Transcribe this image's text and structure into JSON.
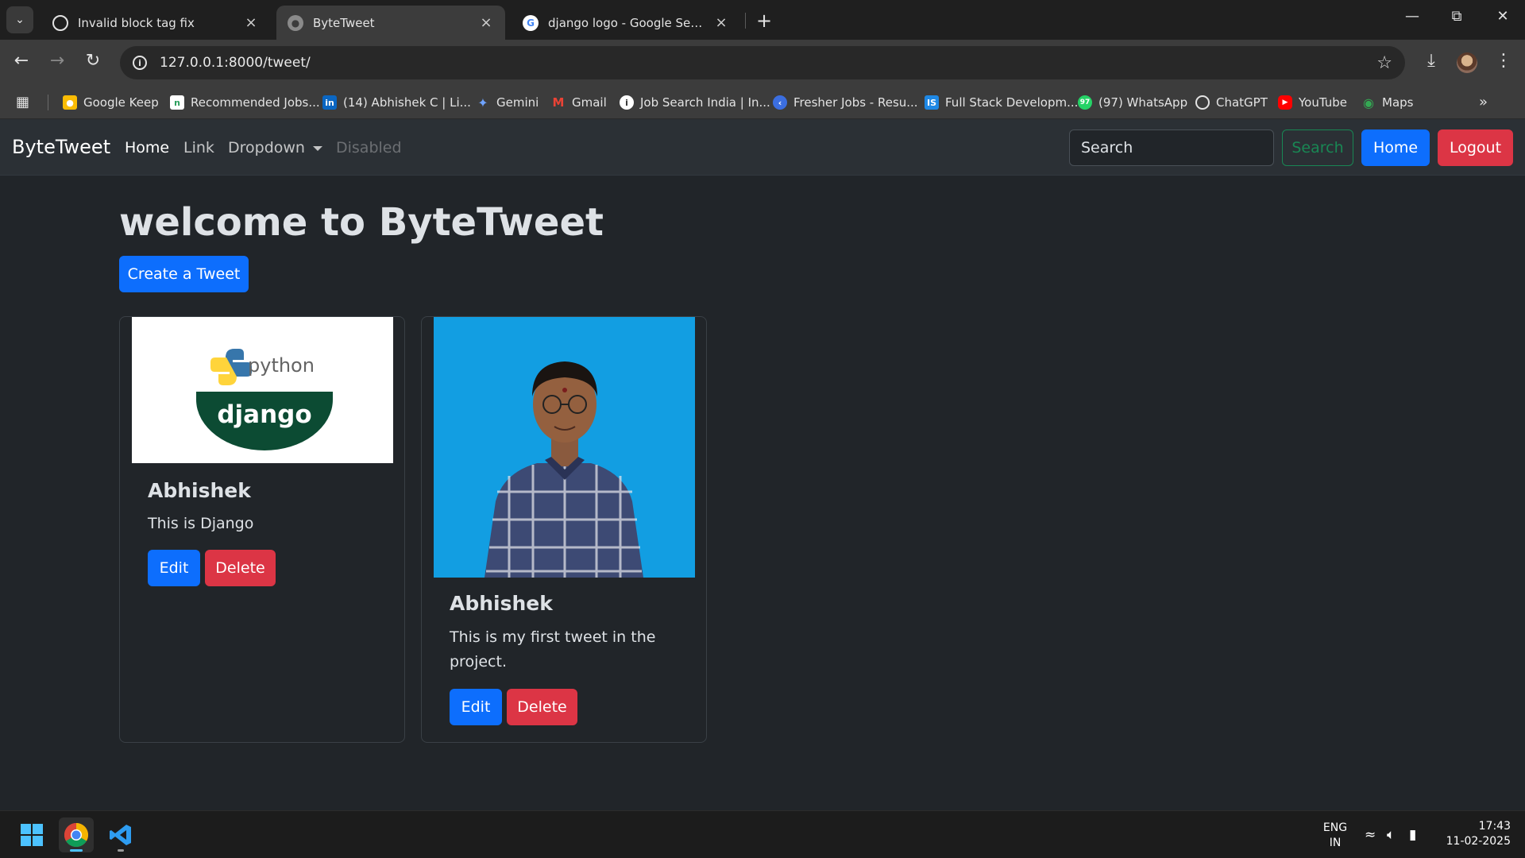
{
  "browser": {
    "tabs": [
      {
        "title": "Invalid block tag fix",
        "icon": "chatgpt-icon",
        "active": false
      },
      {
        "title": "ByteTweet",
        "icon": "globe-icon",
        "active": true
      },
      {
        "title": "django logo - Google Search",
        "icon": "google-icon",
        "active": false
      }
    ],
    "url": "127.0.0.1:8000/tweet/",
    "bookmarks": [
      {
        "label": "Google Keep",
        "icon": "keep-icon",
        "color": "#fbbc04"
      },
      {
        "label": "Recommended Jobs...",
        "icon": "naukri-icon",
        "color": "#ffffff"
      },
      {
        "label": "(14) Abhishek C | Li...",
        "icon": "linkedin-icon",
        "color": "#0a66c2"
      },
      {
        "label": "Gemini",
        "icon": "gemini-icon",
        "color": "#4f8df5"
      },
      {
        "label": "Gmail",
        "icon": "gmail-icon",
        "color": "#ea4335"
      },
      {
        "label": "Job Search India | In...",
        "icon": "indeed-icon",
        "color": "#ffffff"
      },
      {
        "label": "Fresher Jobs - Resu...",
        "icon": "freshersworld-icon",
        "color": "#3b6ee0"
      },
      {
        "label": "Full Stack Developm...",
        "icon": "is-icon",
        "color": "#1e88e5"
      },
      {
        "label": "(97) WhatsApp",
        "icon": "whatsapp-icon",
        "color": "#25d366"
      },
      {
        "label": "ChatGPT",
        "icon": "chatgpt-icon",
        "color": "#ffffff"
      },
      {
        "label": "YouTube",
        "icon": "youtube-icon",
        "color": "#ff0000"
      },
      {
        "label": "Maps",
        "icon": "maps-icon",
        "color": "#34a853"
      }
    ]
  },
  "navbar": {
    "brand": "ByteTweet",
    "links": {
      "home": "Home",
      "link": "Link",
      "dropdown": "Dropdown",
      "disabled": "Disabled"
    },
    "search_placeholder": "Search",
    "search_button": "Search",
    "home_button": "Home",
    "logout_button": "Logout"
  },
  "main": {
    "heading": "welcome to ByteTweet",
    "create_button": "Create a Tweet",
    "tweets": [
      {
        "author": "Abhishek",
        "text": "This is Django",
        "image": "python django logo",
        "image_text": {
          "python": "python",
          "django": "django"
        },
        "edit": "Edit",
        "delete": "Delete"
      },
      {
        "author": "Abhishek",
        "text": "This is my first tweet in the project.",
        "image": "profile photo on blue background",
        "edit": "Edit",
        "delete": "Delete"
      }
    ]
  },
  "taskbar": {
    "lang": "ENG",
    "region": "IN",
    "time": "17:43",
    "date": "11-02-2025"
  },
  "colors": {
    "primary": "#0d6efd",
    "danger": "#dc3545",
    "success": "#198754",
    "page_bg": "#212529",
    "navbar_bg": "#2b3035"
  }
}
